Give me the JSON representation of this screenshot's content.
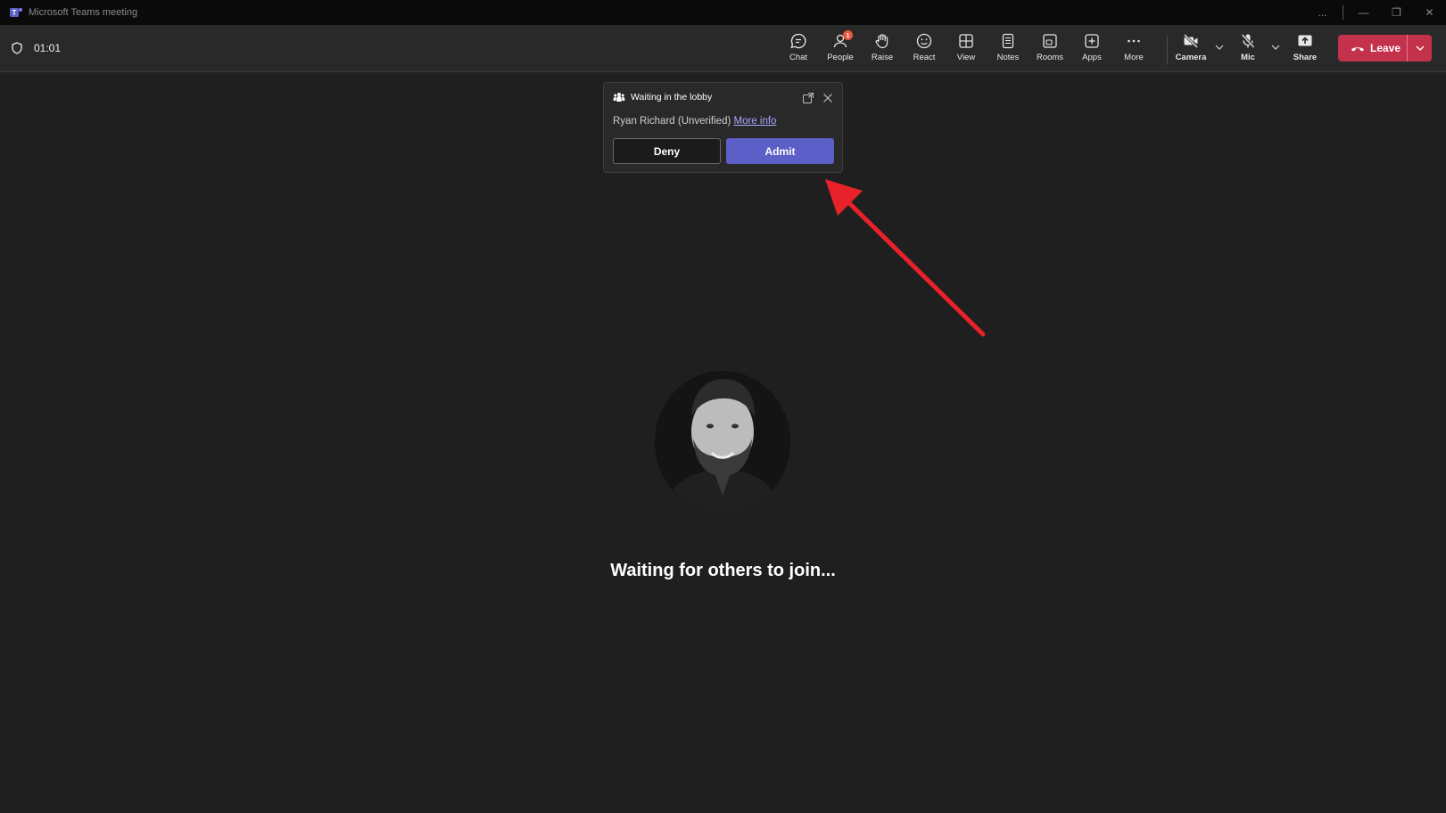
{
  "window": {
    "title": "Microsoft Teams meeting",
    "controls": [
      "...",
      "—",
      "❐",
      "✕"
    ]
  },
  "meeting": {
    "timer": "01:01",
    "icon": "shield-icon"
  },
  "toolbar": {
    "items": [
      {
        "label": "Chat",
        "icon": "chat-icon"
      },
      {
        "label": "People",
        "icon": "people-icon",
        "badge": "1"
      },
      {
        "label": "Raise",
        "icon": "hand-icon"
      },
      {
        "label": "React",
        "icon": "smiley-icon"
      },
      {
        "label": "View",
        "icon": "grid-icon"
      },
      {
        "label": "Notes",
        "icon": "notes-icon"
      },
      {
        "label": "Rooms",
        "icon": "rooms-icon"
      },
      {
        "label": "Apps",
        "icon": "add-app-icon"
      },
      {
        "label": "More",
        "icon": "more-icon"
      },
      {
        "label": "Camera",
        "icon": "camera-off-icon"
      },
      {
        "label": "Mic",
        "icon": "mic-off-icon"
      },
      {
        "label": "Share",
        "icon": "share-icon"
      }
    ],
    "leave_label": "Leave",
    "leave_color": "#c4314b"
  },
  "lobby": {
    "title": "Waiting in the lobby",
    "participant": "Ryan Richard (Unverified)",
    "more_info": "More info",
    "deny_label": "Deny",
    "admit_label": "Admit",
    "admit_color": "#5b5fc7"
  },
  "stage": {
    "status": "Waiting for others to join..."
  },
  "annotation": {
    "arrow_color": "#e8212a"
  }
}
